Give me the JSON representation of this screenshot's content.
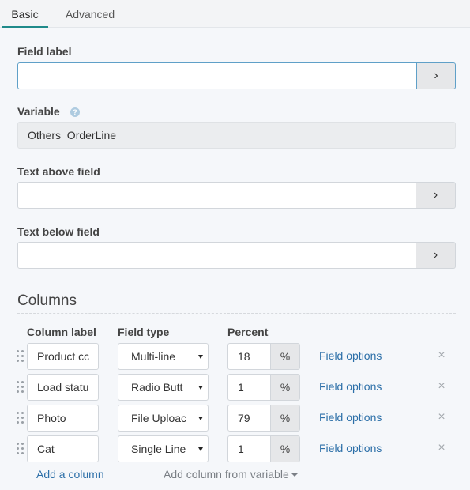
{
  "tabs": [
    {
      "label": "Basic",
      "active": true
    },
    {
      "label": "Advanced",
      "active": false
    }
  ],
  "field_label": {
    "label": "Field label",
    "value": "",
    "button_icon": "chevron-right-icon"
  },
  "variable": {
    "label": "Variable",
    "value": "Others_OrderLine",
    "help_icon": "help-icon",
    "help_glyph": "?"
  },
  "text_above": {
    "label": "Text above field",
    "value": "",
    "button_icon": "chevron-right-icon"
  },
  "text_below": {
    "label": "Text below field",
    "value": "",
    "button_icon": "chevron-right-icon"
  },
  "arrow_glyph": "›",
  "columns": {
    "title": "Columns",
    "headers": {
      "label": "Column label",
      "type": "Field type",
      "percent": "Percent"
    },
    "rows": [
      {
        "label": "Product cc",
        "type": "Multi-line",
        "percent": "18",
        "unit": "%",
        "options": "Field options",
        "remove": "×"
      },
      {
        "label": "Load statu",
        "type": "Radio Butt",
        "percent": "1",
        "unit": "%",
        "options": "Field options",
        "remove": "×"
      },
      {
        "label": "Photo",
        "type": "File Uploac",
        "percent": "79",
        "unit": "%",
        "options": "Field options",
        "remove": "×"
      },
      {
        "label": "Cat",
        "type": "Single Line",
        "percent": "1",
        "unit": "%",
        "options": "Field options",
        "remove": "×"
      }
    ],
    "add_column": "Add a column",
    "add_from_variable": "Add column from variable"
  },
  "colors": {
    "accent": "#1f8a8a",
    "link": "#2c6fa8",
    "focus": "#5fa0c8"
  }
}
